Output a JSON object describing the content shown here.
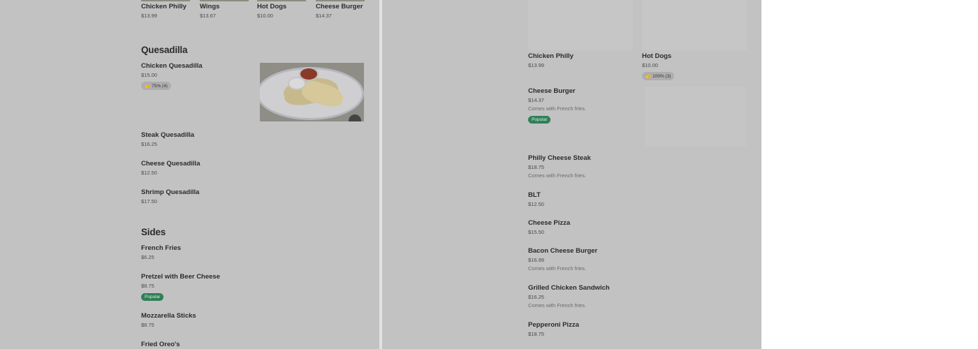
{
  "left": {
    "top_items": [
      {
        "name": "Chicken Philly",
        "price": "$13.99"
      },
      {
        "name": "Wings",
        "price": "$13.67"
      },
      {
        "name": "Hot Dogs",
        "price": "$10.00"
      },
      {
        "name": "Cheese Burger",
        "price": "$14.37"
      }
    ],
    "quesadilla": {
      "heading": "Quesadilla",
      "featured": {
        "name": "Chicken Quesadilla",
        "price": "$15.00",
        "rating": "75% (4)"
      },
      "items": [
        {
          "name": "Steak Quesadilla",
          "price": "$16.25"
        },
        {
          "name": "Cheese Quesadilla",
          "price": "$12.50"
        },
        {
          "name": "Shrimp Quesadilla",
          "price": "$17.50"
        }
      ]
    },
    "sides": {
      "heading": "Sides",
      "items": [
        {
          "name": "French Fries",
          "price": "$6.25",
          "badge": ""
        },
        {
          "name": "Pretzel with Beer Cheese",
          "price": "$8.75",
          "badge": "Popular"
        },
        {
          "name": "Mozzarella Sticks",
          "price": "$8.75",
          "badge": ""
        },
        {
          "name": "Fried Oreo's",
          "price": "",
          "badge": ""
        }
      ]
    }
  },
  "right": {
    "tiles": [
      {
        "name": "Chicken Philly",
        "price": "$13.99",
        "rating": ""
      },
      {
        "name": "Hot Dogs",
        "price": "$10.00",
        "rating": "100% (3)"
      }
    ],
    "cheese_burger": {
      "name": "Cheese Burger",
      "price": "$14.37",
      "desc": "Comes with French fries.",
      "badge": "Popular"
    },
    "items": [
      {
        "name": "Philly Cheese Steak",
        "price": "$18.75",
        "desc": "Comes with French fries."
      },
      {
        "name": "BLT",
        "price": "$12.50",
        "desc": ""
      },
      {
        "name": "Cheese Pizza",
        "price": "$15.50",
        "desc": ""
      },
      {
        "name": "Bacon Cheese Burger",
        "price": "$16.99",
        "desc": "Comes with French fries."
      },
      {
        "name": "Grilled Chicken Sandwich",
        "price": "$16.25",
        "desc": "Comes with French fries."
      },
      {
        "name": "Pepperoni Pizza",
        "price": "$18.75",
        "desc": ""
      }
    ]
  },
  "icons": {
    "like": "thumbs-up-icon"
  },
  "colors": {
    "popular_badge": "#2f7f57",
    "overlay": "#c2c2c2",
    "background": "#ffffff"
  }
}
